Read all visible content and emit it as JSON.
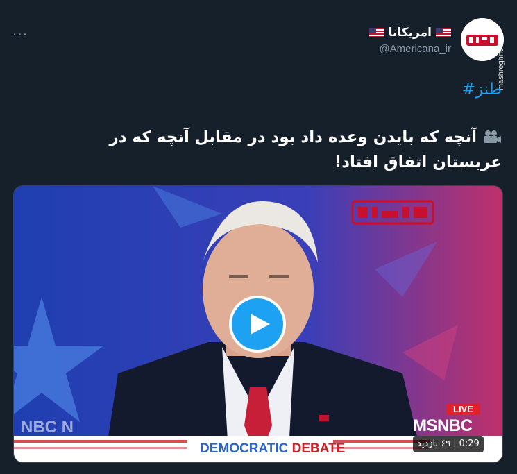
{
  "more_label": "···",
  "account": {
    "name": "امریکانا",
    "handle": "@Americana_ir"
  },
  "side_watermark": "mashreghnews.ir",
  "hashtag": "#طنز",
  "tweet_text": "آنچه که بایدن وعده داد بود در مقابل آنچه که در عربستان اتفاق افتاد!",
  "video": {
    "duration": "0:29",
    "views": "۶۹ بازدید",
    "live_label": "LIVE",
    "channel": "MSNBC",
    "left_logo": "NBC N",
    "banner_part1": "DEMOCRATIC",
    "banner_part2": "DEBATE"
  },
  "colors": {
    "background": "#15202b",
    "accent": "#1da1f2",
    "muted": "#8899a6"
  },
  "icons": [
    "more-icon",
    "us-flag-icon",
    "camera-icon",
    "play-icon"
  ]
}
